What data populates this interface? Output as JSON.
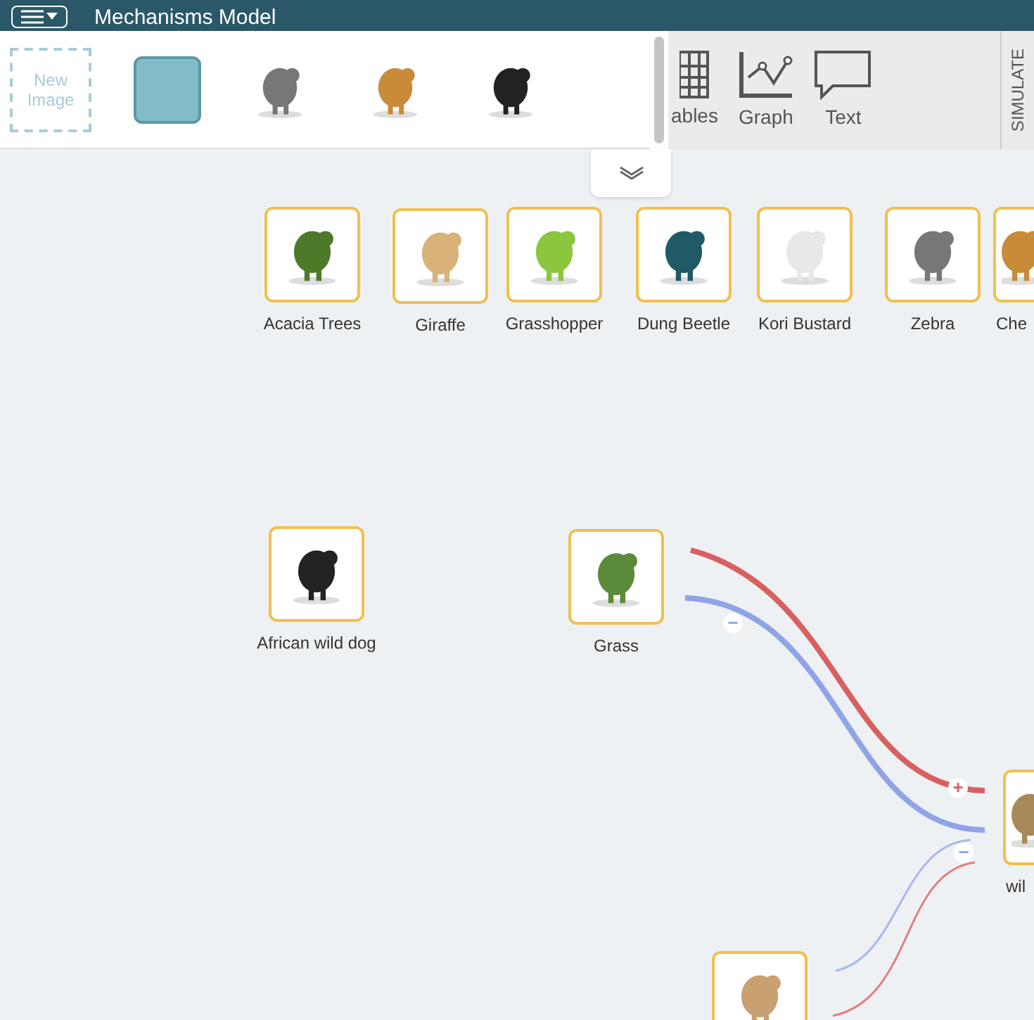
{
  "header": {
    "title": "Mechanisms Model"
  },
  "palette": {
    "new_image": "New Image",
    "items": [
      {
        "kind": "square"
      },
      {
        "kind": "picture"
      },
      {
        "kind": "picture"
      },
      {
        "kind": "picture"
      }
    ]
  },
  "toolbar": {
    "items": [
      {
        "kind": "table",
        "label": "ables"
      },
      {
        "kind": "graph",
        "label": "Graph"
      },
      {
        "kind": "text",
        "label": "Text"
      }
    ],
    "simulate": "SIMULATE"
  },
  "canvas": {
    "nodes": [
      {
        "kind": "picture",
        "label": "Acacia Trees"
      },
      {
        "kind": "picture",
        "label": "Giraffe"
      },
      {
        "kind": "picture",
        "label": "Grasshopper"
      },
      {
        "kind": "picture",
        "label": "Dung Beetle"
      },
      {
        "kind": "picture",
        "label": "Kori Bustard"
      },
      {
        "kind": "picture",
        "label": "Zebra"
      },
      {
        "kind": "picture",
        "label": "Che"
      },
      {
        "kind": "picture",
        "label": "African wild dog"
      },
      {
        "kind": "picture",
        "label": "Grass"
      },
      {
        "kind": "picture",
        "label": "wil"
      },
      {
        "kind": "picture"
      }
    ],
    "links": [
      {
        "kind": "increase",
        "sign": "+"
      },
      {
        "kind": "decrease",
        "sign": "−"
      },
      {
        "kind": "decrease",
        "sign": "−"
      },
      {
        "kind": "increase"
      }
    ]
  }
}
